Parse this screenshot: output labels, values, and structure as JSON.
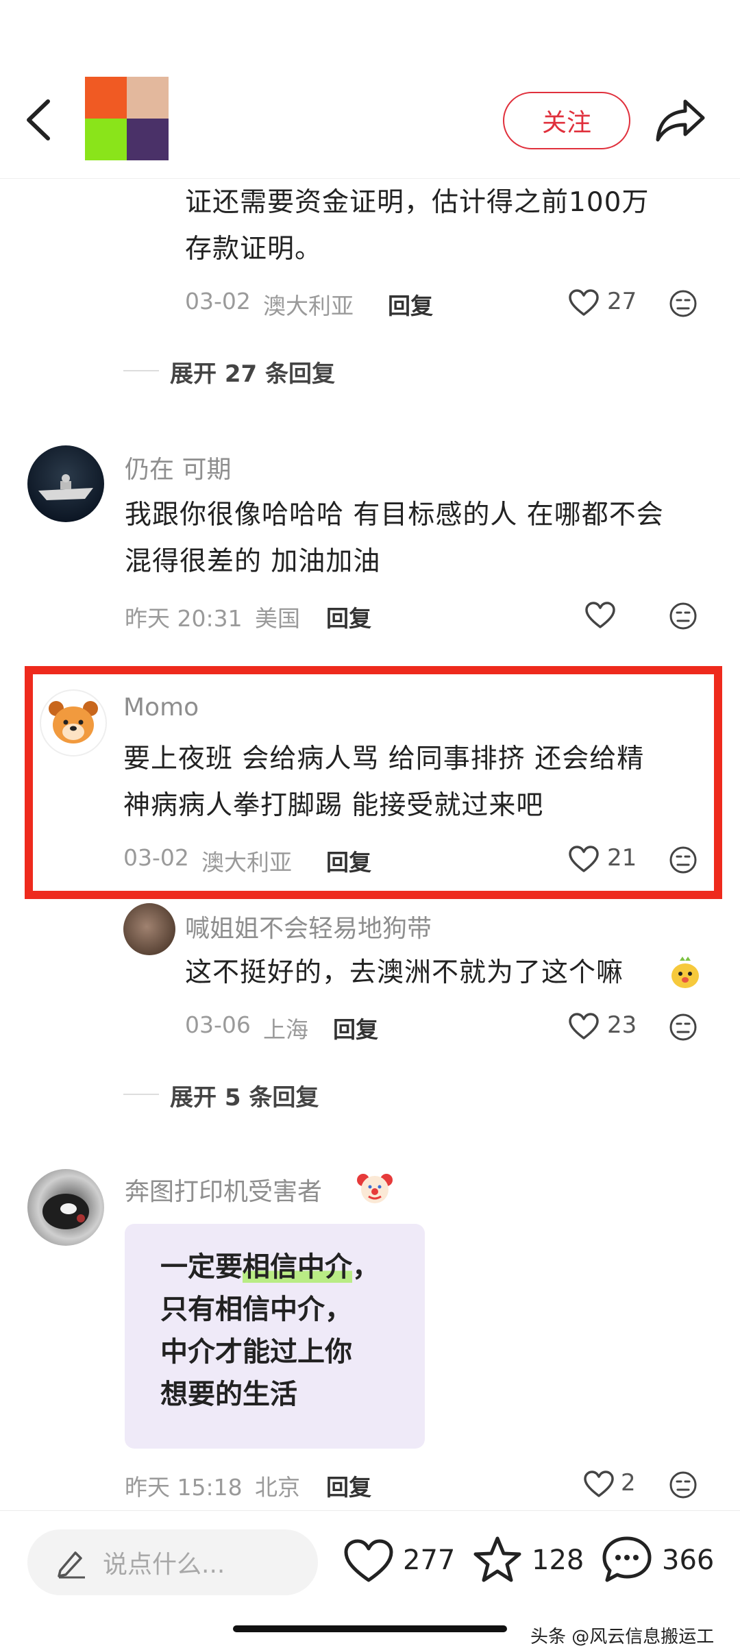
{
  "header": {
    "follow_label": "关注",
    "avatar_colors": [
      "#f05a23",
      "#e3b89d",
      "#8ae41a",
      "#4a3168"
    ]
  },
  "comments": [
    {
      "text_lines": [
        "证还需要资金证明，估计得之前100万",
        "存款证明。"
      ],
      "date": "03-02",
      "location": "澳大利亚",
      "reply_label": "回复",
      "likes": "27"
    },
    {
      "expand_label": "展开 27 条回复"
    },
    {
      "username": "仍在 可期",
      "text_lines": [
        "我跟你很像哈哈哈 有目标感的人 在哪都不会",
        "混得很差的 加油加油"
      ],
      "date": "昨天 20:31",
      "location": "美国",
      "reply_label": "回复"
    },
    {
      "username": "Momo",
      "text_lines": [
        "要上夜班 会给病人骂 给同事排挤 还会给精",
        "神病病人拳打脚踢 能接受就过来吧"
      ],
      "date": "03-02",
      "location": "澳大利亚",
      "reply_label": "回复",
      "likes": "21"
    },
    {
      "username": "喊姐姐不会轻易地狗带",
      "text": "这不挺好的，去澳洲不就为了这个嘛",
      "date": "03-06",
      "location": "上海",
      "reply_label": "回复",
      "likes": "23"
    },
    {
      "expand_label": "展开 5 条回复"
    },
    {
      "username": "奔图打印机受害者",
      "quote_lines": [
        "一定要相信中介，",
        "只有相信中介，",
        "中介才能过上你",
        "想要的生活"
      ],
      "quote_marked": "相信中介",
      "date": "昨天 15:18",
      "location": "北京",
      "reply_label": "回复",
      "likes": "2"
    }
  ],
  "bottom_bar": {
    "input_placeholder": "说点什么...",
    "likes": "277",
    "stars": "128",
    "comments": "366"
  },
  "watermark": "头条 @风云信息搬运工",
  "colors": {
    "accent": "#e0303c",
    "highlight_box": "#ee2a1d",
    "quote_bg": "#efeaf8",
    "marker": "#b9ec85"
  }
}
